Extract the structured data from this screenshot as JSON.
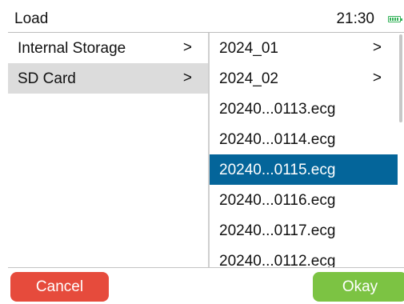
{
  "header": {
    "title": "Load",
    "time": "21:30"
  },
  "left_panel": {
    "items": [
      {
        "label": "Internal Storage",
        "chevron": ">"
      },
      {
        "label": "SD Card",
        "chevron": ">"
      }
    ],
    "selected": "SD Card"
  },
  "right_panel": {
    "items": [
      {
        "label": "2024_01",
        "chevron": ">"
      },
      {
        "label": "2024_02",
        "chevron": ">"
      },
      {
        "label": "20240...0113.ecg"
      },
      {
        "label": "20240...0114.ecg"
      },
      {
        "label": "20240...0115.ecg"
      },
      {
        "label": "20240...0116.ecg"
      },
      {
        "label": "20240...0117.ecg"
      },
      {
        "label": "20240...0112.ecg"
      }
    ],
    "selected": "20240...0115.ecg"
  },
  "buttons": {
    "cancel": "Cancel",
    "okay": "Okay"
  },
  "colors": {
    "selected_file": "#04659a",
    "selected_folder": "#dcdcdc",
    "cancel": "#e64b3c",
    "okay": "#7cc343",
    "battery": "#35b35a"
  },
  "icons": {
    "battery": "battery-icon",
    "chevron": "chevron-right-icon"
  }
}
